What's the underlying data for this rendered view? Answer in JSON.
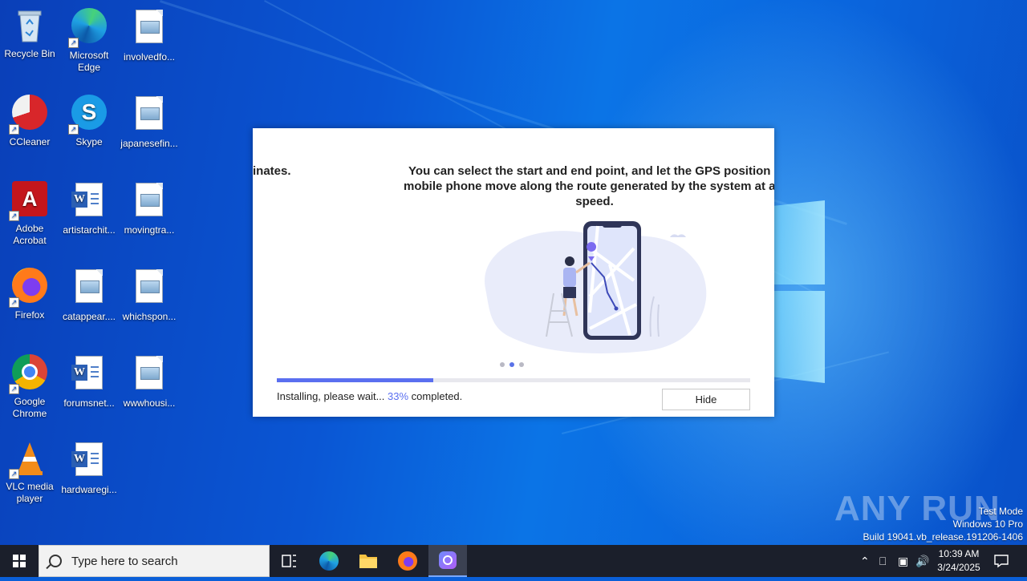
{
  "desktop": {
    "icons": [
      {
        "label": "Recycle Bin",
        "icon": "recycle-bin-icon"
      },
      {
        "label": "Microsoft Edge",
        "icon": "edge-icon"
      },
      {
        "label": "involvedfo...",
        "icon": "image-file-icon"
      },
      {
        "label": "CCleaner",
        "icon": "ccleaner-icon"
      },
      {
        "label": "Skype",
        "icon": "skype-icon"
      },
      {
        "label": "japanesefin...",
        "icon": "image-file-icon"
      },
      {
        "label": "Adobe Acrobat",
        "icon": "acrobat-icon"
      },
      {
        "label": "artistarchit...",
        "icon": "word-doc-icon"
      },
      {
        "label": "movingtra...",
        "icon": "image-file-icon"
      },
      {
        "label": "Firefox",
        "icon": "firefox-icon"
      },
      {
        "label": "catappear....",
        "icon": "image-file-icon"
      },
      {
        "label": "whichspon...",
        "icon": "image-file-icon"
      },
      {
        "label": "Google Chrome",
        "icon": "chrome-icon"
      },
      {
        "label": "forumsnet...",
        "icon": "word-doc-icon"
      },
      {
        "label": "wwwhousi...",
        "icon": "image-file-icon"
      },
      {
        "label": "VLC media player",
        "icon": "vlc-icon"
      },
      {
        "label": "hardwaregi...",
        "icon": "word-doc-icon"
      }
    ]
  },
  "installer": {
    "slide_left_text": "inates.",
    "slide_right_line1": "You can select the start and end point, and let the GPS position c",
    "slide_right_line2": "mobile phone move along the route generated by the system at a s",
    "slide_right_line3": "speed.",
    "progress_percent": 33,
    "status_prefix": "Installing, please wait... ",
    "status_percent": "33%",
    "status_suffix": " completed.",
    "hide_label": "Hide",
    "dots": 3,
    "active_dot": 1
  },
  "watermark": {
    "brand": "ANY RUN",
    "line1": "Test Mode",
    "line2": "Windows 10 Pro",
    "line3": "Build 19041.vb_release.191206-1406"
  },
  "taskbar": {
    "search_placeholder": "Type here to search",
    "apps": [
      "task-view-icon",
      "edge-icon",
      "file-explorer-icon",
      "firefox-icon",
      "installer-app-icon"
    ],
    "time": "10:39 AM",
    "date": "3/24/2025"
  }
}
